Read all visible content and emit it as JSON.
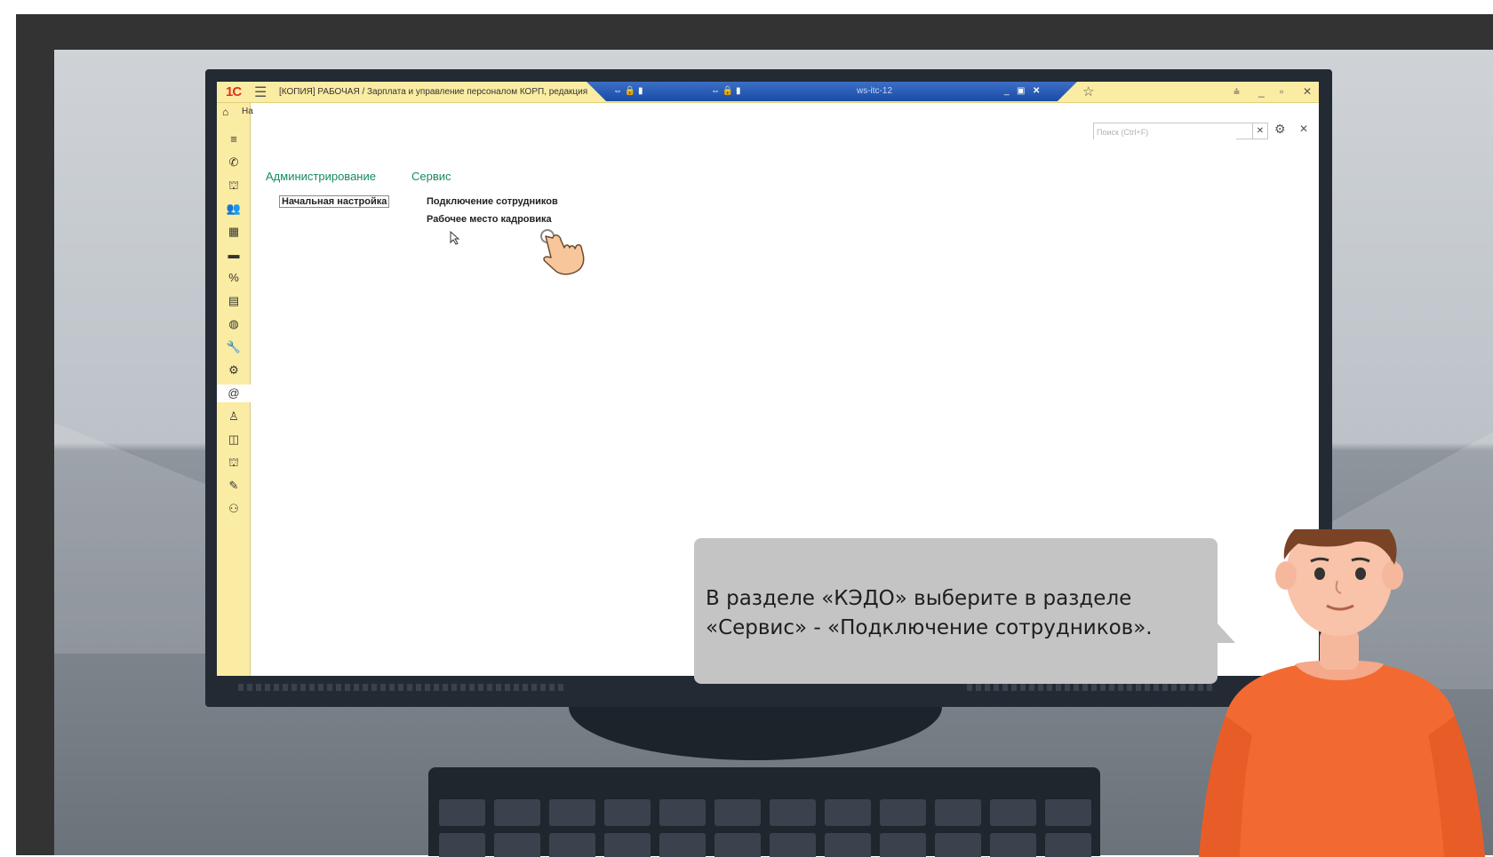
{
  "app": {
    "logo": "1С",
    "title": "[КОПИЯ] РАБОЧАЯ / Зарплата и управление персоналом КОРП, редакция",
    "home_tab": "На",
    "remote_host": "ws-itc-12"
  },
  "sidebar": {
    "icons": [
      "menu-icon",
      "phone-icon",
      "graduation-icon",
      "users-icon",
      "calculator-icon",
      "card-icon",
      "percent-icon",
      "documents-icon",
      "globe-icon",
      "wrench-icon",
      "gear-icon",
      "at-icon",
      "person-icon",
      "sections-icon",
      "graduation-icon",
      "edit-icon",
      "people-icon"
    ],
    "glyphs": [
      "≡",
      "✆",
      "⛫",
      "👥",
      "▦",
      "▬",
      "%",
      "▤",
      "◍",
      "🔧",
      "⚙",
      "@",
      "♙",
      "◫",
      "⛫",
      "✎",
      "⚇"
    ],
    "active_index": 11
  },
  "search": {
    "placeholder": "Поиск (Ctrl+F)",
    "value": ""
  },
  "sections": {
    "administration": {
      "title": "Администрирование",
      "items": [
        "Начальная настройка"
      ]
    },
    "service": {
      "title": "Сервис",
      "items": [
        "Подключение сотрудников",
        "Рабочее место кадровика"
      ]
    }
  },
  "bubble": {
    "text": "В разделе «КЭДО» выберите в разделе «Сервис» - «Подключение сотрудников»."
  },
  "colors": {
    "accent_green": "#178a5c",
    "panel_yellow": "#fbeca3",
    "shirt": "#f26a32",
    "rdp_blue": "#1a4ca6"
  }
}
